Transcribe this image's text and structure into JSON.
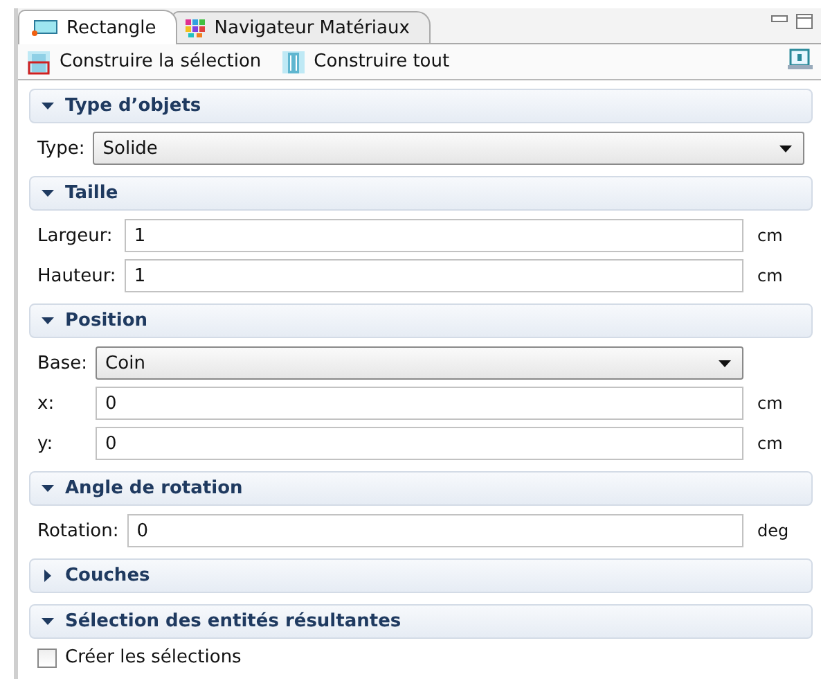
{
  "tabs": [
    {
      "label": "Rectangle",
      "selected": true
    },
    {
      "label": "Navigateur Matériaux",
      "selected": false
    }
  ],
  "toolbar": {
    "buttons": [
      {
        "label": "Construire la sélection",
        "kind": "selection"
      },
      {
        "label": "Construire tout",
        "kind": "all"
      }
    ]
  },
  "sections": [
    {
      "title": "Type d’objets",
      "expanded": true,
      "rows": [
        {
          "kind": "select",
          "label": "Type:",
          "value": "Solide"
        }
      ]
    },
    {
      "title": "Taille",
      "expanded": true,
      "rows": [
        {
          "kind": "field",
          "label": "Largeur:",
          "value": "1",
          "unit": "cm"
        },
        {
          "kind": "field",
          "label": "Hauteur:",
          "value": "1",
          "unit": "cm"
        }
      ]
    },
    {
      "title": "Position",
      "expanded": true,
      "rows": [
        {
          "kind": "select",
          "label": "Base:",
          "value": "Coin"
        },
        {
          "kind": "field",
          "label": "x:",
          "value": "0",
          "unit": "cm"
        },
        {
          "kind": "field",
          "label": "y:",
          "value": "0",
          "unit": "cm"
        }
      ]
    },
    {
      "title": "Angle de rotation",
      "expanded": true,
      "rows": [
        {
          "kind": "field",
          "label": "Rotation:",
          "value": "0",
          "unit": "deg"
        }
      ]
    },
    {
      "title": "Couches",
      "expanded": false
    },
    {
      "title": "Sélection des entités résultantes",
      "expanded": true,
      "rows": [
        {
          "kind": "checkbox",
          "label": "Créer les sélections",
          "checked": false
        }
      ]
    }
  ]
}
